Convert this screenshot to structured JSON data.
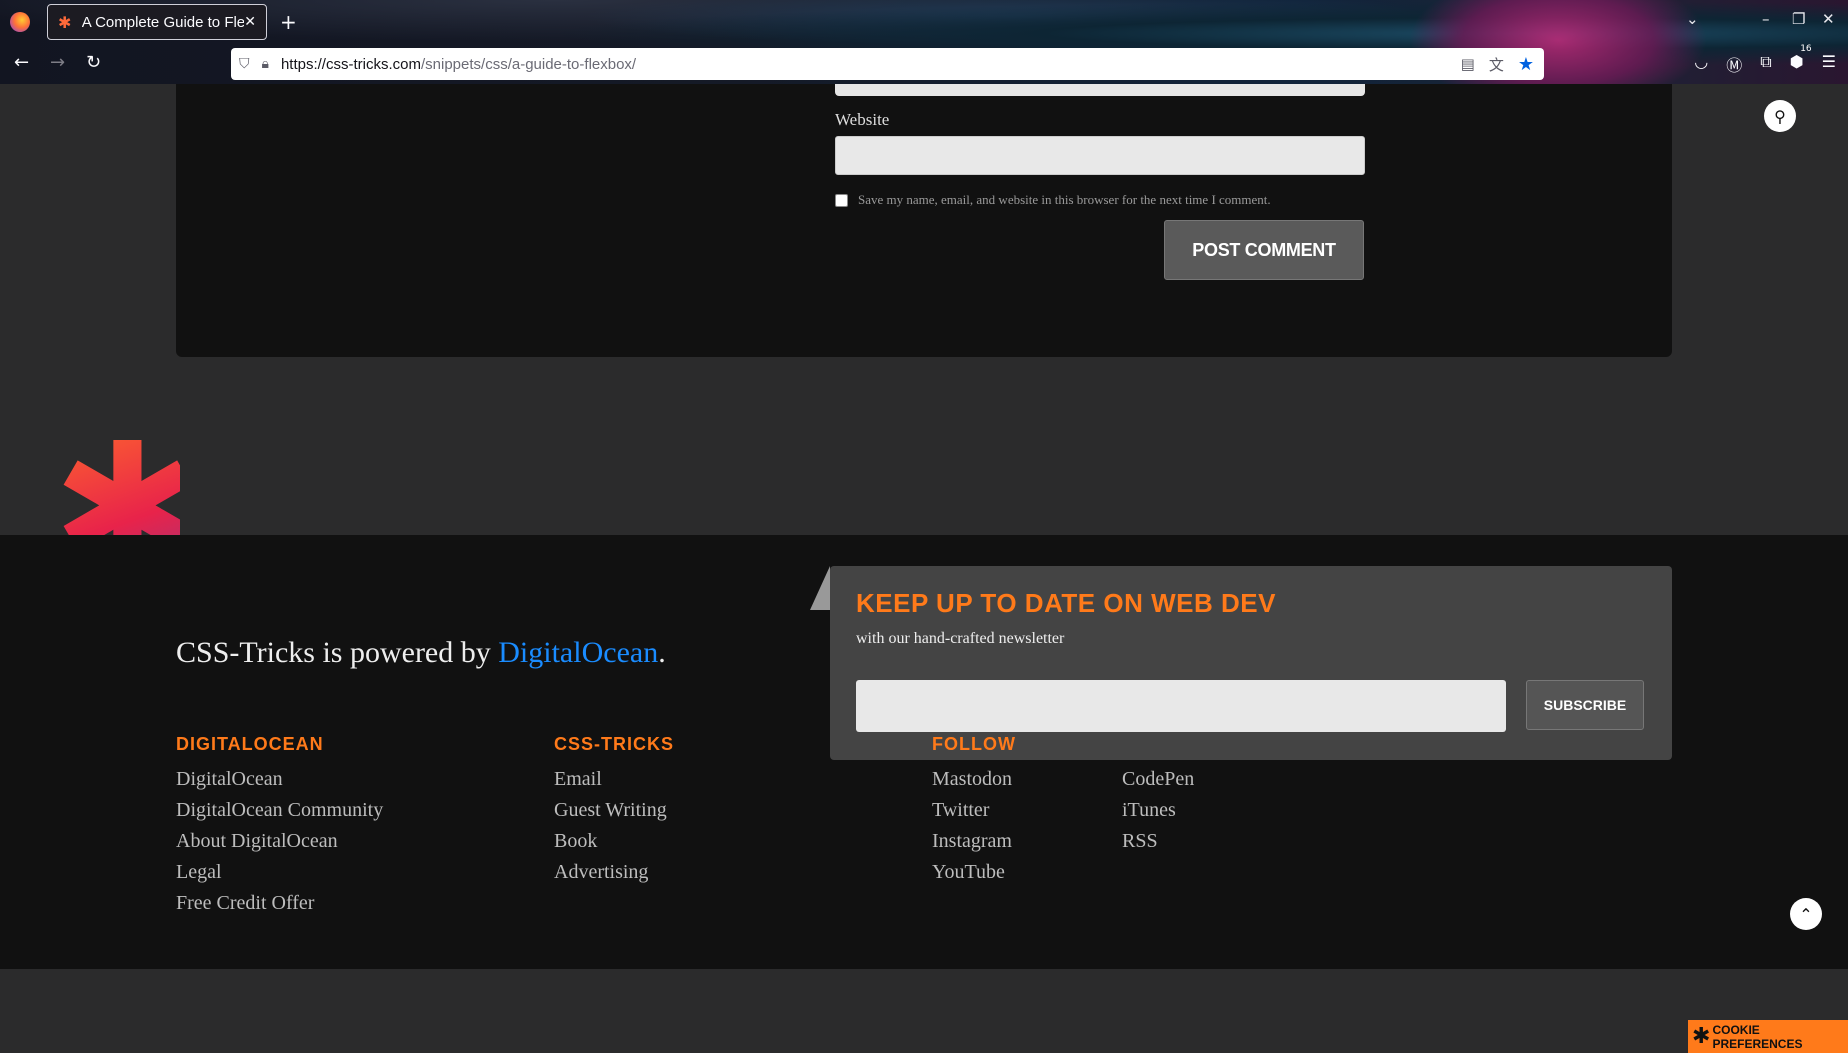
{
  "browser": {
    "tab_title": "A Complete Guide to Fle",
    "tab_close": "✕",
    "new_tab": "+",
    "url_host": "https://css-tricks.com",
    "url_path": "/snippets/css/a-guide-to-flexbox/",
    "extension_badge": "16"
  },
  "form": {
    "website_label": "Website",
    "save_label": "Save my name, email, and website in this browser for the next time I comment.",
    "post_button": "POST COMMENT"
  },
  "newsletter": {
    "title": "KEEP UP TO DATE ON WEB DEV",
    "subtitle": "with our hand-crafted newsletter",
    "subscribe_button": "SUBSCRIBE"
  },
  "footer": {
    "powered_prefix": "CSS-Tricks is powered by ",
    "powered_link": "DigitalOcean",
    "powered_suffix": ".",
    "columns": [
      {
        "heading": "DIGITALOCEAN",
        "links": [
          "DigitalOcean",
          "DigitalOcean Community",
          "About DigitalOcean",
          "Legal",
          "Free Credit Offer"
        ]
      },
      {
        "heading": "CSS-TRICKS",
        "links": [
          "Email",
          "Guest Writing",
          "Book",
          "Advertising"
        ]
      },
      {
        "heading": "FOLLOW",
        "links": [
          "Mastodon",
          "Twitter",
          "Instagram",
          "YouTube"
        ]
      },
      {
        "heading": "",
        "links": [
          "CodePen",
          "iTunes",
          "RSS"
        ]
      }
    ]
  },
  "cookie": {
    "label": "COOKIE PREFERENCES"
  },
  "colors": {
    "accent": "#ff7a1a",
    "link": "#1a8cff",
    "page_bg": "#2b2b2c",
    "footer_bg": "#111111"
  }
}
